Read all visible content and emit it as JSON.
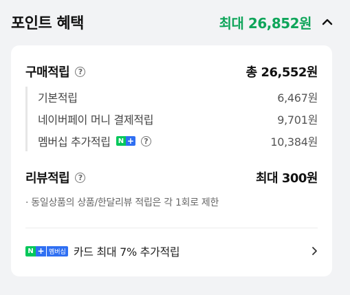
{
  "header": {
    "title": "포인트 혜택",
    "max_label": "최대 26,852원"
  },
  "purchase": {
    "label": "구매적립",
    "total": "총 26,552원",
    "items": [
      {
        "label": "기본적립",
        "value": "6,467원"
      },
      {
        "label": "네이버페이 머니 결제적립",
        "value": "9,701원"
      },
      {
        "label": "멤버십 추가적립",
        "value": "10,384원"
      }
    ]
  },
  "review": {
    "label": "리뷰적립",
    "value": "최대 300원",
    "note": "· 동일상품의 상품/한달리뷰 적립은 각 1회로 제한"
  },
  "promo": {
    "badge_n": "N",
    "badge_plus": "+",
    "badge_member": "멤버십",
    "text": "카드 최대 7% 추가적립"
  },
  "colors": {
    "accent_green": "#0fa55a",
    "naver_green": "#03c75a",
    "plus_blue": "#2f6ff2"
  },
  "icons": [
    "chevron-up-icon",
    "help-icon",
    "chevron-right-icon",
    "naver-plus-badge"
  ]
}
